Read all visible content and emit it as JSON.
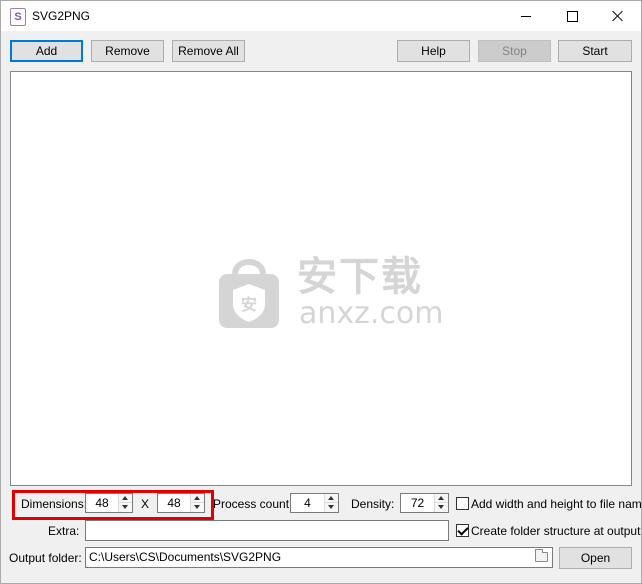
{
  "window": {
    "title": "SVG2PNG"
  },
  "toolbar": {
    "add": "Add",
    "remove": "Remove",
    "remove_all": "Remove All",
    "help": "Help",
    "stop": "Stop",
    "start": "Start"
  },
  "watermark": {
    "cn_text": "安下载",
    "en_text": "anxz.com",
    "shield_text": "安"
  },
  "options": {
    "dimensions_label": "Dimensions:",
    "width": "48",
    "by": "X",
    "height": "48",
    "process_count_label": "Process count:",
    "process_count": "4",
    "density_label": "Density:",
    "density": "72",
    "add_wh_label": "Add width and height to file name",
    "add_wh_checked": false,
    "extra_label": "Extra:",
    "extra_value": "",
    "create_folder_label": "Create folder structure at output",
    "create_folder_checked": true,
    "output_label": "Output folder:",
    "output_path": "C:\\Users\\CS\\Documents\\SVG2PNG",
    "open": "Open"
  },
  "colors": {
    "highlight": "#e00000",
    "accent": "#0078d7"
  }
}
